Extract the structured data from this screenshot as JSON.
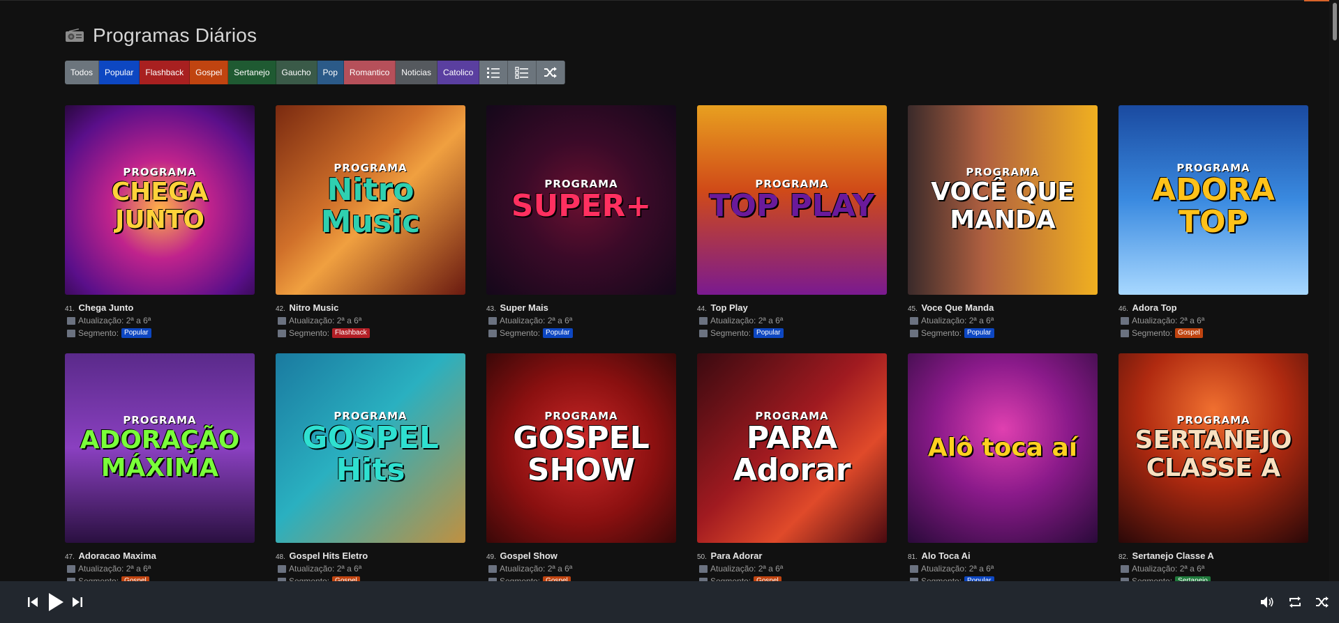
{
  "page": {
    "title": "Programas Diários",
    "title_icon": "radio-icon"
  },
  "filters": [
    {
      "label": "Todos",
      "key": "todos"
    },
    {
      "label": "Popular",
      "key": "popular"
    },
    {
      "label": "Flashback",
      "key": "flashback"
    },
    {
      "label": "Gospel",
      "key": "gospel"
    },
    {
      "label": "Sertanejo",
      "key": "sertanejo"
    },
    {
      "label": "Gaucho",
      "key": "gaucho"
    },
    {
      "label": "Pop",
      "key": "pop"
    },
    {
      "label": "Romantico",
      "key": "romantico"
    },
    {
      "label": "Noticias",
      "key": "noticias"
    },
    {
      "label": "Catolico",
      "key": "catolico"
    }
  ],
  "filter_icons": [
    "list-numbered-icon",
    "list-checked-icon",
    "shuffle-icon"
  ],
  "labels": {
    "update": "Atualização:",
    "segment": "Segmento:"
  },
  "programs": [
    {
      "num": "41.",
      "name": "Chega Junto",
      "update": "2ª a 6ª",
      "segment": "Popular",
      "badge": "popular",
      "cover_sup": "PROGRAMA",
      "cover_main": "CHEGA JUNTO"
    },
    {
      "num": "42.",
      "name": "Nitro Music",
      "update": "2ª a 6ª",
      "segment": "Flashback",
      "badge": "flashback",
      "cover_sup": "PROGRAMA",
      "cover_main": "Nitro Music"
    },
    {
      "num": "43.",
      "name": "Super Mais",
      "update": "2ª a 6ª",
      "segment": "Popular",
      "badge": "popular",
      "cover_sup": "PROGRAMA",
      "cover_main": "SUPER+"
    },
    {
      "num": "44.",
      "name": "Top Play",
      "update": "2ª a 6ª",
      "segment": "Popular",
      "badge": "popular",
      "cover_sup": "PROGRAMA",
      "cover_main": "TOP PLAY"
    },
    {
      "num": "45.",
      "name": "Voce Que Manda",
      "update": "2ª a 6ª",
      "segment": "Popular",
      "badge": "popular",
      "cover_sup": "PROGRAMA",
      "cover_main": "VOCÊ QUE MANDA"
    },
    {
      "num": "46.",
      "name": "Adora Top",
      "update": "2ª a 6ª",
      "segment": "Gospel",
      "badge": "gospel",
      "cover_sup": "PROGRAMA",
      "cover_main": "ADORA TOP"
    },
    {
      "num": "47.",
      "name": "Adoracao Maxima",
      "update": "2ª a 6ª",
      "segment": "Gospel",
      "badge": "gospel",
      "cover_sup": "PROGRAMA",
      "cover_main": "ADORAÇÃO MÁXIMA"
    },
    {
      "num": "48.",
      "name": "Gospel Hits Eletro",
      "update": "2ª a 6ª",
      "segment": "Gospel",
      "badge": "gospel",
      "cover_sup": "PROGRAMA",
      "cover_main": "GOSPEL Hits"
    },
    {
      "num": "49.",
      "name": "Gospel Show",
      "update": "2ª a 6ª",
      "segment": "Gospel",
      "badge": "gospel",
      "cover_sup": "PROGRAMA",
      "cover_main": "GOSPEL SHOW"
    },
    {
      "num": "50.",
      "name": "Para Adorar",
      "update": "2ª a 6ª",
      "segment": "Gospel",
      "badge": "gospel",
      "cover_sup": "PROGRAMA",
      "cover_main": "PARA Adorar"
    },
    {
      "num": "81.",
      "name": "Alo Toca Ai",
      "update": "2ª a 6ª",
      "segment": "Popular",
      "badge": "popular",
      "cover_sup": "",
      "cover_main": "Alô toca aí"
    },
    {
      "num": "82.",
      "name": "Sertanejo Classe A",
      "update": "2ª a 6ª",
      "segment": "Sertanejo",
      "badge": "sertanejo",
      "cover_sup": "PROGRAMA",
      "cover_main": "SERTANEJO CLASSE A"
    }
  ],
  "player": {
    "left_controls": [
      "skip-back-icon",
      "play-icon",
      "skip-forward-icon"
    ],
    "right_controls": [
      "volume-icon",
      "repeat-icon",
      "shuffle-icon"
    ]
  }
}
